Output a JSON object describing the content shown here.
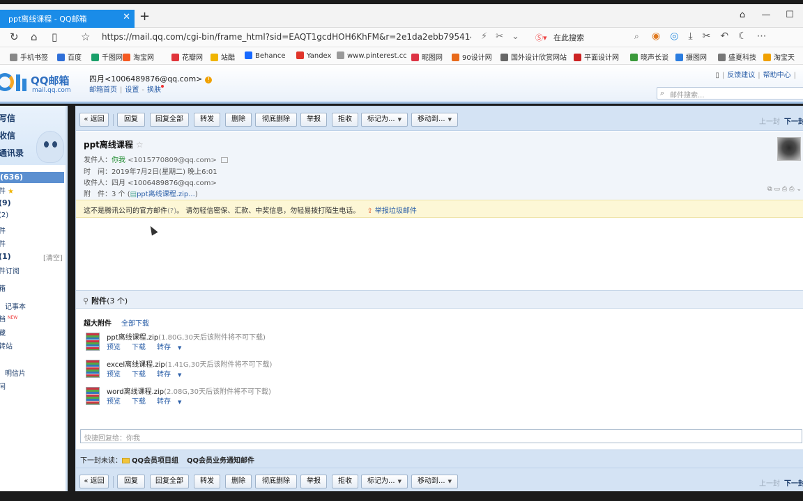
{
  "browser": {
    "tab_title": "ppt离线课程 - QQ邮箱",
    "url": "https://mail.qq.com/cgi-bin/frame_html?sid=EAQT1gcdHOH6KhFM&r=2e1da2ebb795414def9",
    "search_placeholder": "在此搜索",
    "bookmarks": [
      "手机书签",
      "百度",
      "千图网",
      "淘宝网",
      "花瓣网",
      "站酷",
      "Behance",
      "Yandex",
      "www.pinterest.cc",
      "昵图网",
      "90设计网",
      "国外设计欣赏网站",
      "平面设计网",
      "晓声长谈",
      "摄图网",
      "盛夏科技",
      "淘宝天"
    ],
    "bookmark_colors": [
      "#888",
      "#2f6fd8",
      "#1aa06a",
      "#f55a22",
      "#e0343a",
      "#f0b400",
      "#1769ff",
      "#e0342a",
      "#999",
      "#d34",
      "#e86a1a",
      "#666",
      "#c22",
      "#3b9a3b",
      "#2b7de0",
      "#777",
      "#f0a000"
    ]
  },
  "header": {
    "logo_text": "QQ邮箱",
    "logo_sub": "mail.qq.com",
    "user": "四月<1006489876@qq.com>",
    "links": [
      "邮箱首页",
      "设置",
      "换肤"
    ],
    "right_links": [
      "反馈建议",
      "帮助中心"
    ],
    "mail_search_placeholder": "邮件搜索..."
  },
  "sidebar": {
    "top_items": [
      "写信",
      "收信",
      "通讯录"
    ],
    "inbox": "(636)",
    "items": [
      {
        "label": "件",
        "suffix": "★"
      },
      {
        "label": "(9)",
        "bold": true
      },
      {
        "label": "(2)"
      },
      {
        "label": "件"
      },
      {
        "label": "件"
      },
      {
        "label": "(1)",
        "bold": true,
        "extra": "[清空]"
      },
      {
        "label": "件订阅"
      },
      {
        "label": "箱"
      },
      {
        "label": "记事本"
      },
      {
        "label": "档",
        "badge": "NEW"
      },
      {
        "label": "藏"
      },
      {
        "label": "转站"
      },
      {
        "label": "明信片"
      },
      {
        "label": "间"
      }
    ]
  },
  "toolbar": {
    "back": "« 返回",
    "buttons": [
      "回复",
      "回复全部",
      "转发",
      "删除",
      "彻底删除",
      "举报",
      "拒收"
    ],
    "mark_as": "标记为...",
    "move_to": "移动到...",
    "prev": "上一封",
    "next": "下一封"
  },
  "mail": {
    "subject": "ppt离线课程",
    "from_label": "发件人：",
    "from_name": "你我",
    "from_addr": "<1015770809@qq.com>",
    "time_label": "时　间：",
    "time": "2019年7月2日(星期二) 晚上6:01",
    "to_label": "收件人：",
    "to": "四月 <1006489876@qq.com>",
    "attach_label": "附　件：",
    "attach_summary": "3 个 (",
    "attach_first": "ppt离线课程.zip...",
    "attach_close": ")"
  },
  "warning": {
    "text": "这不是腾讯公司的官方邮件",
    "hint": "(?)",
    "tail": "。 请勿轻信密保、汇款、中奖信息，勿轻易拨打陌生电话。",
    "report": "举报垃圾邮件"
  },
  "attachments": {
    "title": "附件",
    "count": "(3 个)",
    "super_label": "超大附件",
    "download_all": "全部下载",
    "files": [
      {
        "name": "ppt离线课程.zip",
        "meta": "(1.80G,30天后该附件将不可下载)"
      },
      {
        "name": "excel离线课程.zip",
        "meta": "(1.41G,30天后该附件将不可下载)"
      },
      {
        "name": "word离线课程.zip",
        "meta": "(2.08G,30天后该附件将不可下载)"
      }
    ],
    "actions": [
      "预览",
      "下载",
      "转存"
    ]
  },
  "quick_reply": {
    "placeholder": "快捷回复给：你我"
  },
  "next_unread": {
    "label": "下一封未读：",
    "items": [
      "QQ会员项目组",
      "QQ会员业务通知邮件"
    ]
  }
}
